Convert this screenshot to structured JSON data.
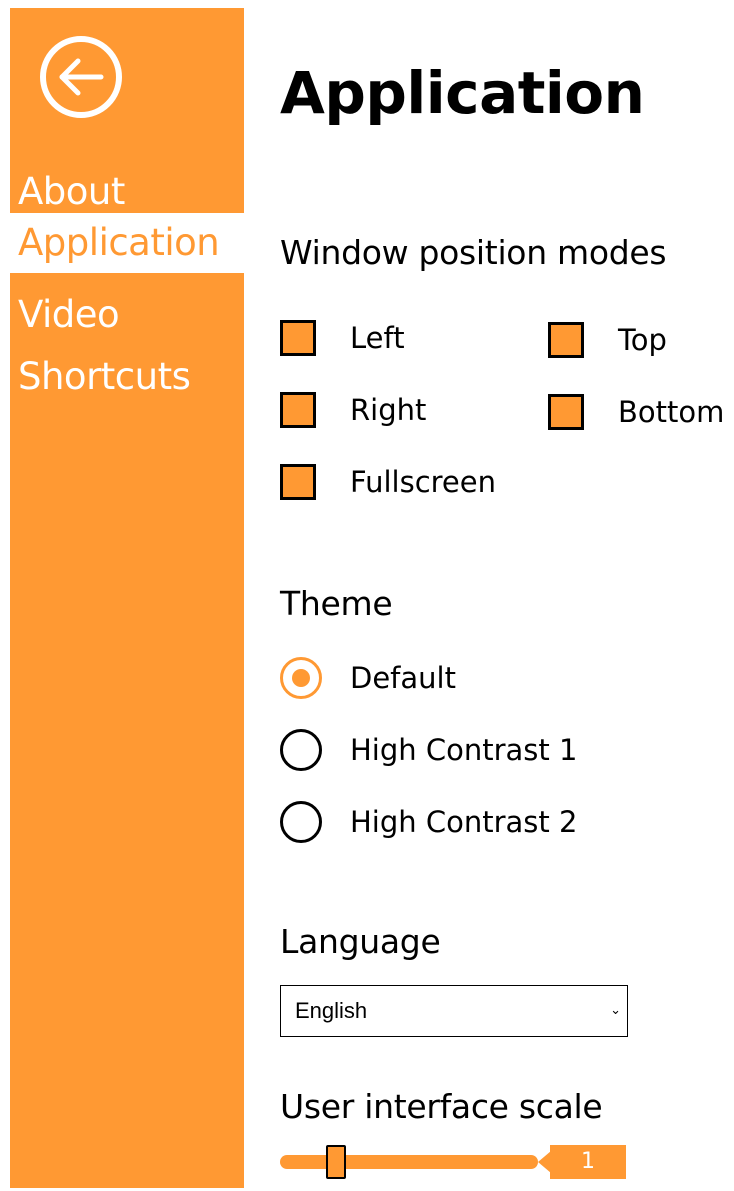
{
  "accent_color": "#FF9933",
  "sidebar": {
    "back_icon": "back-arrow-icon",
    "items": [
      {
        "label": "About",
        "active": false
      },
      {
        "label": "Application",
        "active": true
      },
      {
        "label": "Video",
        "active": false
      },
      {
        "label": "Shortcuts",
        "active": false
      }
    ]
  },
  "page": {
    "title": "Application"
  },
  "window_position": {
    "title": "Window position modes",
    "options": [
      "Left",
      "Right",
      "Fullscreen",
      "Top",
      "Bottom"
    ]
  },
  "theme": {
    "title": "Theme",
    "options": [
      "Default",
      "High Contrast 1",
      "High Contrast 2"
    ],
    "selected": "Default"
  },
  "language": {
    "title": "Language",
    "selected": "English"
  },
  "ui_scale": {
    "title": "User interface scale",
    "value": "1"
  }
}
